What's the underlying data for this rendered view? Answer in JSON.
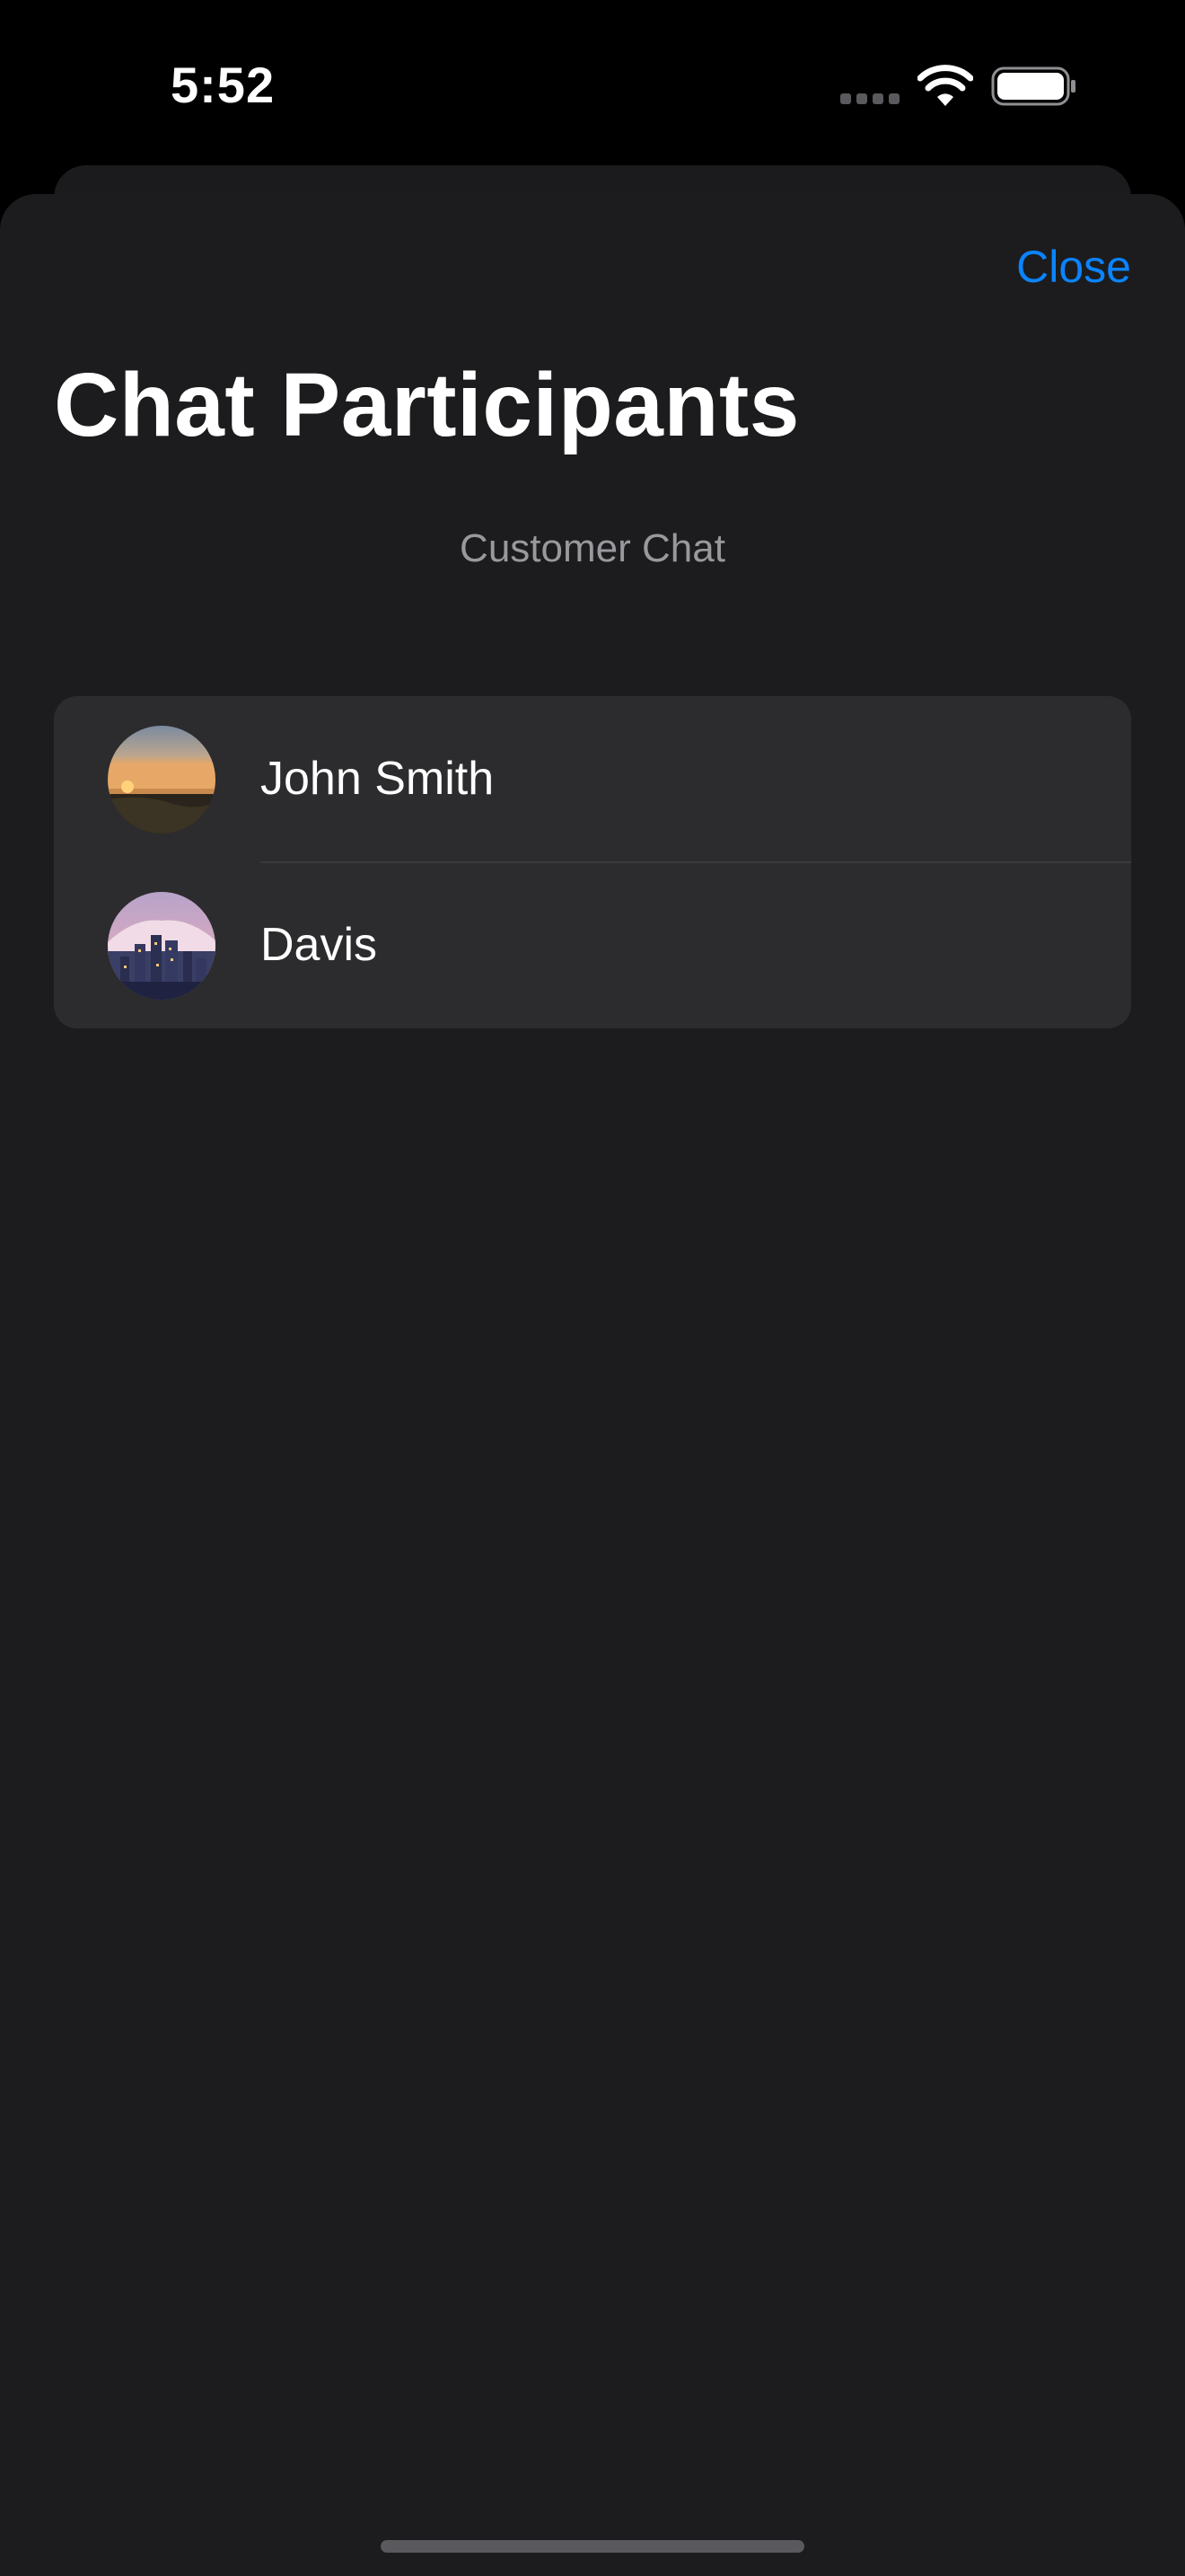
{
  "status_bar": {
    "time": "5:52",
    "icons": [
      "signal-icon",
      "wifi-icon",
      "battery-icon"
    ]
  },
  "header": {
    "close_label": "Close",
    "title": "Chat Participants",
    "subtitle": "Customer Chat"
  },
  "participants": [
    {
      "name": "John Smith",
      "avatar": "sunset-beach-photo"
    },
    {
      "name": "Davis",
      "avatar": "city-skyline-mountain-photo"
    }
  ],
  "colors": {
    "accent": "#0a84ff",
    "sheet_background": "#1c1c1e",
    "list_background": "#2c2c2e",
    "secondary_text": "#98989d",
    "separator": "#3a3a3c"
  }
}
